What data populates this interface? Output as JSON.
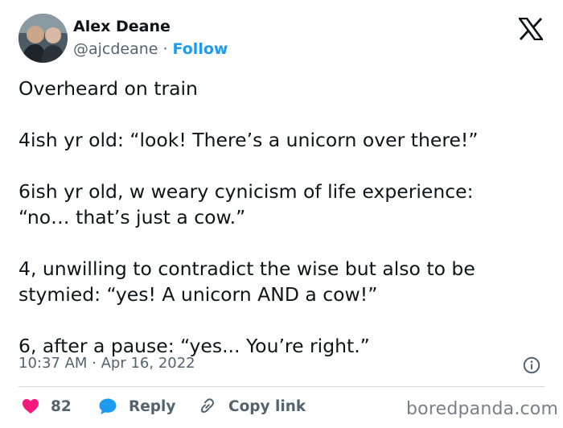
{
  "author": {
    "name": "Alex Deane",
    "handle": "@ajcdeane",
    "separator": "·",
    "follow_label": "Follow"
  },
  "tweet": {
    "paragraphs": [
      [
        "Overheard on train"
      ],
      [
        "4ish yr old: “look! There’s a unicorn over there!”"
      ],
      [
        "6ish yr old, w weary cynicism of life experience:",
        "“no… that’s just a cow.”"
      ],
      [
        "4, unwilling to contradict the wise but also to be",
        "stymied: “yes! A unicorn AND a cow!”"
      ],
      [
        "6, after a pause: “yes... You’re right.”"
      ]
    ],
    "timestamp": "10:37 AM · Apr 16, 2022"
  },
  "actions": {
    "likes_count": "82",
    "reply_label": "Reply",
    "copy_link_label": "Copy link"
  },
  "watermark": "boredpanda.com",
  "icons": {
    "like": "heart-icon",
    "reply": "speech-bubble-icon",
    "copy": "link-icon",
    "info": "info-icon",
    "brand": "x-logo-icon"
  },
  "colors": {
    "like": "#f91880",
    "reply": "#1d9bf0",
    "link": "#1d9bf0",
    "text": "#0f1419",
    "secondary": "#536471"
  }
}
